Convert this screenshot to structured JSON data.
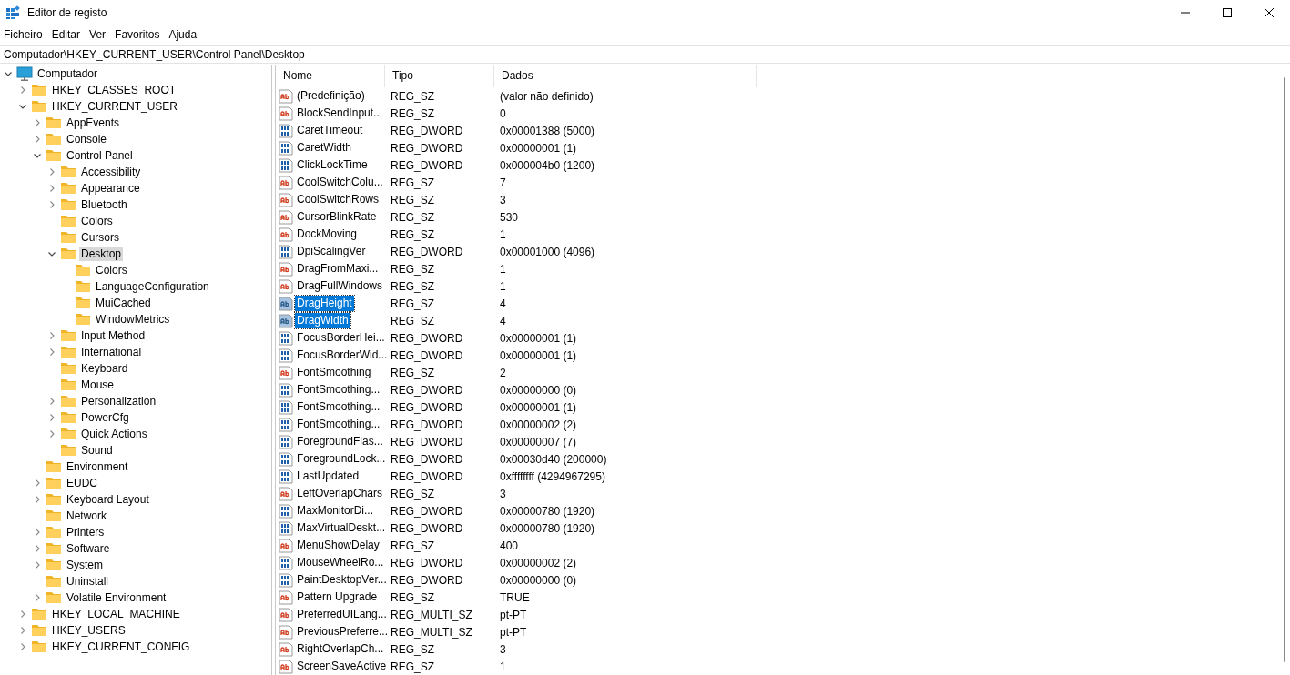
{
  "window": {
    "title": "Editor de registo"
  },
  "menu": [
    "Ficheiro",
    "Editar",
    "Ver",
    "Favoritos",
    "Ajuda"
  ],
  "address": "Computador\\HKEY_CURRENT_USER\\Control Panel\\Desktop",
  "tree": [
    {
      "label": "Computador",
      "kind": "computer",
      "expandable": true,
      "expanded": true,
      "selected": false,
      "children": [
        {
          "label": "HKEY_CLASSES_ROOT",
          "kind": "folder",
          "expandable": true,
          "expanded": false,
          "selected": false
        },
        {
          "label": "HKEY_CURRENT_USER",
          "kind": "folder",
          "expandable": true,
          "expanded": true,
          "selected": false,
          "children": [
            {
              "label": "AppEvents",
              "kind": "folder",
              "expandable": true,
              "expanded": false,
              "selected": false
            },
            {
              "label": "Console",
              "kind": "folder",
              "expandable": true,
              "expanded": false,
              "selected": false
            },
            {
              "label": "Control Panel",
              "kind": "folder",
              "expandable": true,
              "expanded": true,
              "selected": false,
              "children": [
                {
                  "label": "Accessibility",
                  "kind": "folder",
                  "expandable": true,
                  "expanded": false,
                  "selected": false
                },
                {
                  "label": "Appearance",
                  "kind": "folder",
                  "expandable": true,
                  "expanded": false,
                  "selected": false
                },
                {
                  "label": "Bluetooth",
                  "kind": "folder",
                  "expandable": true,
                  "expanded": false,
                  "selected": false
                },
                {
                  "label": "Colors",
                  "kind": "folder",
                  "expandable": false,
                  "selected": false
                },
                {
                  "label": "Cursors",
                  "kind": "folder",
                  "expandable": false,
                  "selected": false
                },
                {
                  "label": "Desktop",
                  "kind": "folder",
                  "expandable": true,
                  "expanded": true,
                  "selected": true,
                  "children": [
                    {
                      "label": "Colors",
                      "kind": "folder",
                      "expandable": false,
                      "selected": false
                    },
                    {
                      "label": "LanguageConfiguration",
                      "kind": "folder",
                      "expandable": false,
                      "selected": false
                    },
                    {
                      "label": "MuiCached",
                      "kind": "folder",
                      "expandable": false,
                      "selected": false
                    },
                    {
                      "label": "WindowMetrics",
                      "kind": "folder",
                      "expandable": false,
                      "selected": false
                    }
                  ]
                },
                {
                  "label": "Input Method",
                  "kind": "folder",
                  "expandable": true,
                  "expanded": false,
                  "selected": false
                },
                {
                  "label": "International",
                  "kind": "folder",
                  "expandable": true,
                  "expanded": false,
                  "selected": false
                },
                {
                  "label": "Keyboard",
                  "kind": "folder",
                  "expandable": false,
                  "selected": false
                },
                {
                  "label": "Mouse",
                  "kind": "folder",
                  "expandable": false,
                  "selected": false
                },
                {
                  "label": "Personalization",
                  "kind": "folder",
                  "expandable": true,
                  "expanded": false,
                  "selected": false
                },
                {
                  "label": "PowerCfg",
                  "kind": "folder",
                  "expandable": true,
                  "expanded": false,
                  "selected": false
                },
                {
                  "label": "Quick Actions",
                  "kind": "folder",
                  "expandable": true,
                  "expanded": false,
                  "selected": false
                },
                {
                  "label": "Sound",
                  "kind": "folder",
                  "expandable": false,
                  "selected": false
                }
              ]
            },
            {
              "label": "Environment",
              "kind": "folder",
              "expandable": false,
              "selected": false
            },
            {
              "label": "EUDC",
              "kind": "folder",
              "expandable": true,
              "expanded": false,
              "selected": false
            },
            {
              "label": "Keyboard Layout",
              "kind": "folder",
              "expandable": true,
              "expanded": false,
              "selected": false
            },
            {
              "label": "Network",
              "kind": "folder",
              "expandable": false,
              "selected": false
            },
            {
              "label": "Printers",
              "kind": "folder",
              "expandable": true,
              "expanded": false,
              "selected": false
            },
            {
              "label": "Software",
              "kind": "folder",
              "expandable": true,
              "expanded": false,
              "selected": false
            },
            {
              "label": "System",
              "kind": "folder",
              "expandable": true,
              "expanded": false,
              "selected": false
            },
            {
              "label": "Uninstall",
              "kind": "folder",
              "expandable": false,
              "selected": false
            },
            {
              "label": "Volatile Environment",
              "kind": "folder",
              "expandable": true,
              "expanded": false,
              "selected": false
            }
          ]
        },
        {
          "label": "HKEY_LOCAL_MACHINE",
          "kind": "folder",
          "expandable": true,
          "expanded": false,
          "selected": false
        },
        {
          "label": "HKEY_USERS",
          "kind": "folder",
          "expandable": true,
          "expanded": false,
          "selected": false
        },
        {
          "label": "HKEY_CURRENT_CONFIG",
          "kind": "folder",
          "expandable": true,
          "expanded": false,
          "selected": false
        }
      ]
    }
  ],
  "table": {
    "columns": [
      "Nome",
      "Tipo",
      "Dados"
    ],
    "rows": [
      {
        "kind": "string",
        "name": "(Predefinição)",
        "type": "REG_SZ",
        "data": "(valor não definido)",
        "selected": false
      },
      {
        "kind": "string",
        "name": "BlockSendInput...",
        "type": "REG_SZ",
        "data": "0",
        "selected": false
      },
      {
        "kind": "binary",
        "name": "CaretTimeout",
        "type": "REG_DWORD",
        "data": "0x00001388 (5000)",
        "selected": false
      },
      {
        "kind": "binary",
        "name": "CaretWidth",
        "type": "REG_DWORD",
        "data": "0x00000001 (1)",
        "selected": false
      },
      {
        "kind": "binary",
        "name": "ClickLockTime",
        "type": "REG_DWORD",
        "data": "0x000004b0 (1200)",
        "selected": false
      },
      {
        "kind": "string",
        "name": "CoolSwitchColu...",
        "type": "REG_SZ",
        "data": "7",
        "selected": false
      },
      {
        "kind": "string",
        "name": "CoolSwitchRows",
        "type": "REG_SZ",
        "data": "3",
        "selected": false
      },
      {
        "kind": "string",
        "name": "CursorBlinkRate",
        "type": "REG_SZ",
        "data": "530",
        "selected": false
      },
      {
        "kind": "string",
        "name": "DockMoving",
        "type": "REG_SZ",
        "data": "1",
        "selected": false
      },
      {
        "kind": "binary",
        "name": "DpiScalingVer",
        "type": "REG_DWORD",
        "data": "0x00001000 (4096)",
        "selected": false
      },
      {
        "kind": "string",
        "name": "DragFromMaxi...",
        "type": "REG_SZ",
        "data": "1",
        "selected": false
      },
      {
        "kind": "string",
        "name": "DragFullWindows",
        "type": "REG_SZ",
        "data": "1",
        "selected": false
      },
      {
        "kind": "string",
        "name": "DragHeight",
        "type": "REG_SZ",
        "data": "4",
        "selected": true
      },
      {
        "kind": "string",
        "name": "DragWidth",
        "type": "REG_SZ",
        "data": "4",
        "selected": true
      },
      {
        "kind": "binary",
        "name": "FocusBorderHei...",
        "type": "REG_DWORD",
        "data": "0x00000001 (1)",
        "selected": false
      },
      {
        "kind": "binary",
        "name": "FocusBorderWid...",
        "type": "REG_DWORD",
        "data": "0x00000001 (1)",
        "selected": false
      },
      {
        "kind": "string",
        "name": "FontSmoothing",
        "type": "REG_SZ",
        "data": "2",
        "selected": false
      },
      {
        "kind": "binary",
        "name": "FontSmoothing...",
        "type": "REG_DWORD",
        "data": "0x00000000 (0)",
        "selected": false
      },
      {
        "kind": "binary",
        "name": "FontSmoothing...",
        "type": "REG_DWORD",
        "data": "0x00000001 (1)",
        "selected": false
      },
      {
        "kind": "binary",
        "name": "FontSmoothing...",
        "type": "REG_DWORD",
        "data": "0x00000002 (2)",
        "selected": false
      },
      {
        "kind": "binary",
        "name": "ForegroundFlas...",
        "type": "REG_DWORD",
        "data": "0x00000007 (7)",
        "selected": false
      },
      {
        "kind": "binary",
        "name": "ForegroundLock...",
        "type": "REG_DWORD",
        "data": "0x00030d40 (200000)",
        "selected": false
      },
      {
        "kind": "binary",
        "name": "LastUpdated",
        "type": "REG_DWORD",
        "data": "0xffffffff (4294967295)",
        "selected": false
      },
      {
        "kind": "string",
        "name": "LeftOverlapChars",
        "type": "REG_SZ",
        "data": "3",
        "selected": false
      },
      {
        "kind": "binary",
        "name": "MaxMonitorDi...",
        "type": "REG_DWORD",
        "data": "0x00000780 (1920)",
        "selected": false
      },
      {
        "kind": "binary",
        "name": "MaxVirtualDeskt...",
        "type": "REG_DWORD",
        "data": "0x00000780 (1920)",
        "selected": false
      },
      {
        "kind": "string",
        "name": "MenuShowDelay",
        "type": "REG_SZ",
        "data": "400",
        "selected": false
      },
      {
        "kind": "binary",
        "name": "MouseWheelRo...",
        "type": "REG_DWORD",
        "data": "0x00000002 (2)",
        "selected": false
      },
      {
        "kind": "binary",
        "name": "PaintDesktopVer...",
        "type": "REG_DWORD",
        "data": "0x00000000 (0)",
        "selected": false
      },
      {
        "kind": "string",
        "name": "Pattern Upgrade",
        "type": "REG_SZ",
        "data": "TRUE",
        "selected": false
      },
      {
        "kind": "string",
        "name": "PreferredUILang...",
        "type": "REG_MULTI_SZ",
        "data": "pt-PT",
        "selected": false
      },
      {
        "kind": "string",
        "name": "PreviousPreferre...",
        "type": "REG_MULTI_SZ",
        "data": "pt-PT",
        "selected": false
      },
      {
        "kind": "string",
        "name": "RightOverlapCh...",
        "type": "REG_SZ",
        "data": "3",
        "selected": false
      },
      {
        "kind": "string",
        "name": "ScreenSaveActive",
        "type": "REG_SZ",
        "data": "1",
        "selected": false
      }
    ]
  }
}
